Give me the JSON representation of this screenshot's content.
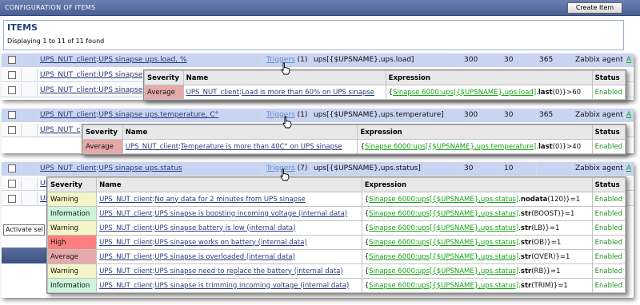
{
  "header": {
    "title": "CONFIGURATION OF ITEMS",
    "create_button": "Create Item"
  },
  "items_box": {
    "title": "ITEMS",
    "displaying": "Displaying 1 to 11 of 11 found"
  },
  "panels": [
    {
      "main_row": {
        "host": "UPS_NUT_client",
        "sep": ":",
        "name": "UPS sinapse ups.load, %",
        "triggers": "Triggers",
        "count": "(1)",
        "key": "ups[{$UPSNAME},ups.load]",
        "interval": "300",
        "history": "30",
        "trends": "365",
        "type": "Zabbix agent",
        "status": "A"
      },
      "stub_rows": [
        "UPS_NUT_client:UPS sinapse",
        "UPS_NUT_client:UPS sinapse"
      ],
      "popup": {
        "headers": [
          "Severity",
          "Name",
          "Expression",
          "Status"
        ],
        "rows": [
          {
            "severity": "Average",
            "sev_class": "average",
            "host": "UPS_NUT_client",
            "sep": ":",
            "name": "Load is more than 60% on UPS sinapse",
            "expr_open": "{",
            "expr_link": "Sinapse 6000:ups[{$UPSNAME},ups.load]",
            "expr_dot": ".",
            "expr_func": "last",
            "expr_rest": "(0)}>60",
            "status": "Enabled"
          }
        ]
      }
    },
    {
      "main_row": {
        "host": "UPS_NUT_client",
        "sep": ":",
        "name": "UPS sinapse ups.temperature, C°",
        "triggers": "Triggers",
        "count": "(1)",
        "key": "ups[{$UPSNAME},ups.temperature]",
        "interval": "300",
        "history": "30",
        "trends": "365",
        "type": "Zabbix agent",
        "status": "A"
      },
      "stub_rows": [
        "UPS_NUT_c"
      ],
      "popup": {
        "headers": [
          "Severity",
          "Name",
          "Expression",
          "Status"
        ],
        "rows": [
          {
            "severity": "Average",
            "sev_class": "average",
            "host": "UPS_NUT_client",
            "sep": ":",
            "name": "Temperature is more than 40C° on UPS sinapse",
            "expr_open": "{",
            "expr_link": "Sinapse 6000:ups[{$UPSNAME},ups.temperature]",
            "expr_dot": ".",
            "expr_func": "last",
            "expr_rest": "(0)}>40",
            "status": "Enabled"
          }
        ]
      }
    },
    {
      "main_row": {
        "host": "UPS_NUT_client",
        "sep": ":",
        "name": "UPS sinapse ups.status",
        "triggers": "Triggers",
        "count": "(7)",
        "key": "ups[{$UPSNAME},ups.status]",
        "interval": "30",
        "history": "10",
        "trends": "",
        "type": "Zabbix agent",
        "status": "A"
      },
      "stub_rows": [
        "UP",
        "UP"
      ],
      "popup": {
        "headers": [
          "Severity",
          "Name",
          "Expression",
          "Status"
        ],
        "rows": [
          {
            "severity": "Warning",
            "sev_class": "warning",
            "host": "UPS_NUT_client",
            "sep": ":",
            "name": "No any data for 2 minutes from UPS sinapse",
            "expr_open": "{",
            "expr_link": "Sinapse 6000:ups[{$UPSNAME},ups.status]",
            "expr_dot": ".",
            "expr_func": "nodata",
            "expr_rest": "(120)}=1",
            "status": "Enabled"
          },
          {
            "severity": "Information",
            "sev_class": "information",
            "host": "UPS_NUT_client",
            "sep": ":",
            "name": "UPS sinapse is boosting incoming voltage (internal data)",
            "expr_open": "{",
            "expr_link": "Sinapse 6000:ups[{$UPSNAME},ups.status]",
            "expr_dot": ".",
            "expr_func": "str",
            "expr_rest": "(BOOST)}=1",
            "status": "Enabled"
          },
          {
            "severity": "Warning",
            "sev_class": "warning",
            "host": "UPS_NUT_client",
            "sep": ":",
            "name": "UPS sinapse battery is low (internal data)",
            "expr_open": "{",
            "expr_link": "Sinapse 6000:ups[{$UPSNAME},ups.status]",
            "expr_dot": ".",
            "expr_func": "str",
            "expr_rest": "(LB)}=1",
            "status": "Enabled"
          },
          {
            "severity": "High",
            "sev_class": "high",
            "host": "UPS_NUT_client",
            "sep": ":",
            "name": "UPS sinapse works on battery (internal data)",
            "expr_open": "{",
            "expr_link": "Sinapse 6000:ups[{$UPSNAME},ups.status]",
            "expr_dot": ".",
            "expr_func": "str",
            "expr_rest": "(OB)}=1",
            "status": "Enabled"
          },
          {
            "severity": "Average",
            "sev_class": "average",
            "host": "UPS_NUT_client",
            "sep": ":",
            "name": "UPS sinapse is overloaded (internal data)",
            "expr_open": "{",
            "expr_link": "Sinapse 6000:ups[{$UPSNAME},ups.status]",
            "expr_dot": ".",
            "expr_func": "str",
            "expr_rest": "(OVER)}=1",
            "status": "Enabled"
          },
          {
            "severity": "Warning",
            "sev_class": "warning",
            "host": "UPS_NUT_client",
            "sep": ":",
            "name": "UPS sinapse need to replace the battery (internal data)",
            "expr_open": "{",
            "expr_link": "Sinapse 6000:ups[{$UPSNAME},ups.status]",
            "expr_dot": ".",
            "expr_func": "str",
            "expr_rest": "(RB)}=1",
            "status": "Enabled"
          },
          {
            "severity": "Information",
            "sev_class": "information",
            "host": "UPS_NUT_client",
            "sep": ":",
            "name": "UPS sinapse is trimming incoming voltage (internal data)",
            "expr_open": "{",
            "expr_link": "Sinapse 6000:ups[{$UPSNAME},ups.status]",
            "expr_dot": ".",
            "expr_func": "str",
            "expr_rest": "(TRIM)}=1",
            "status": "Enabled"
          }
        ]
      }
    }
  ],
  "footer": {
    "action_select": "Activate sel"
  }
}
